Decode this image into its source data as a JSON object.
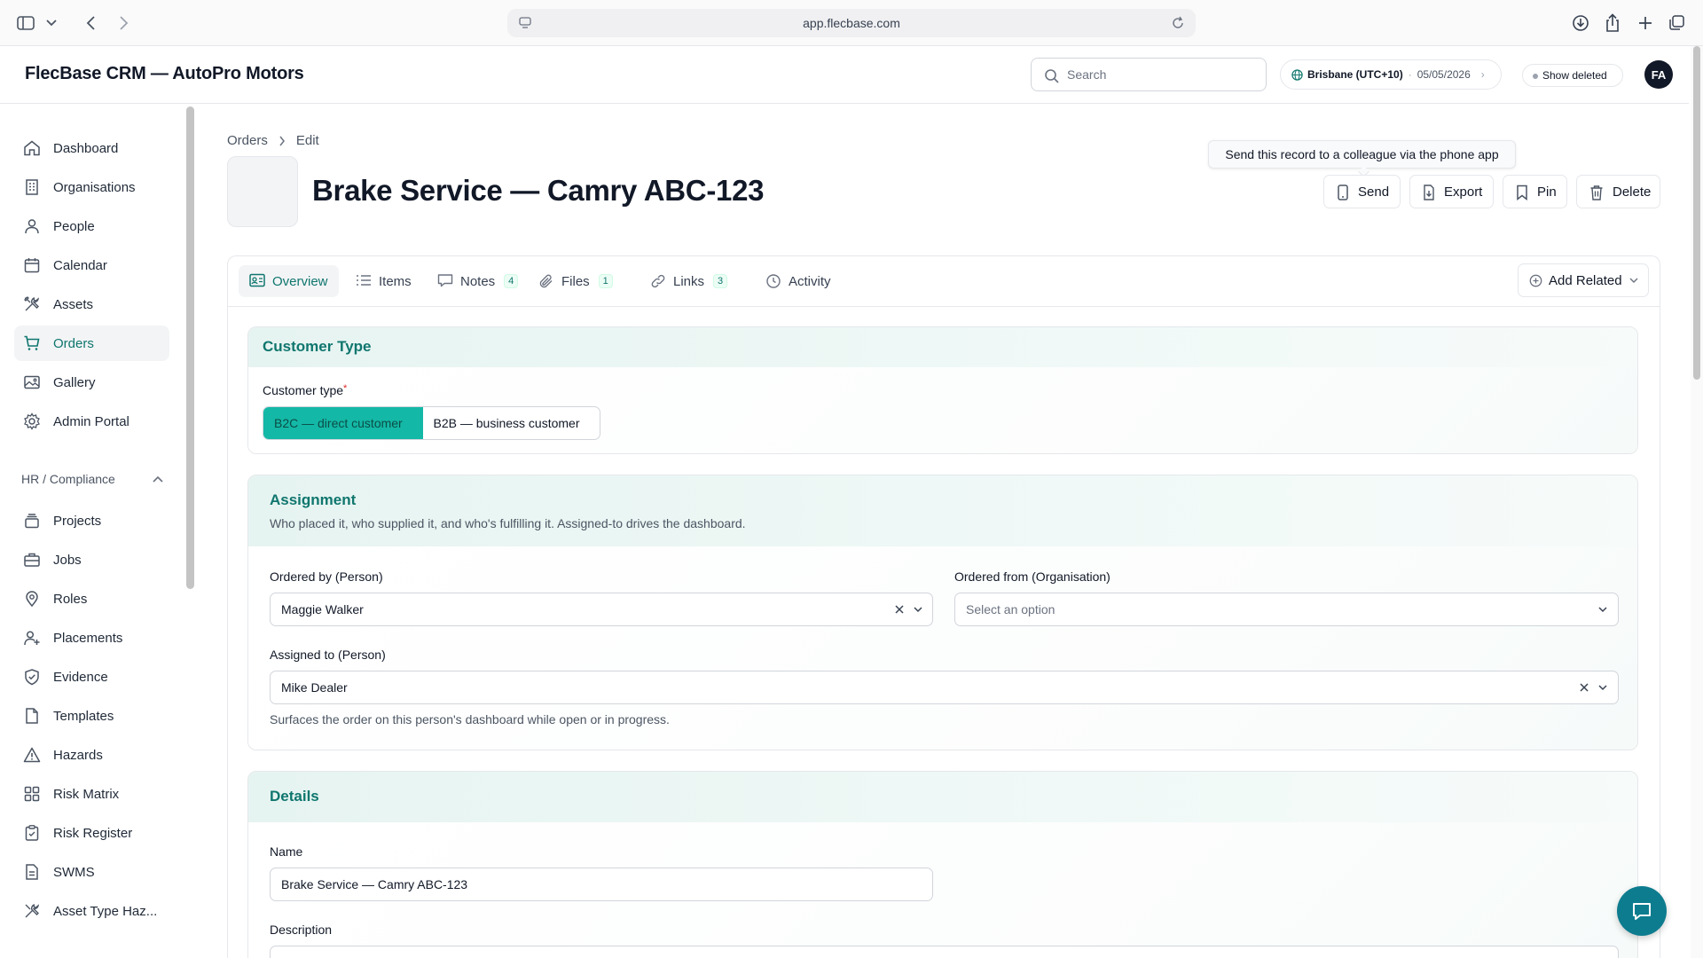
{
  "browser": {
    "url": "app.flecbase.com"
  },
  "app": {
    "brand": "FlecBase CRM — AutoPro Motors",
    "search_placeholder": "Search",
    "timezone": "Brisbane (UTC+10)",
    "date": "05/05/2026",
    "show_deleted": "Show deleted",
    "avatar_initials": "FA"
  },
  "sidebar": {
    "items": [
      {
        "label": "Dashboard",
        "icon": "home-icon"
      },
      {
        "label": "Organisations",
        "icon": "building-icon"
      },
      {
        "label": "People",
        "icon": "person-icon"
      },
      {
        "label": "Calendar",
        "icon": "calendar-icon"
      },
      {
        "label": "Assets",
        "icon": "tools-icon"
      },
      {
        "label": "Orders",
        "icon": "cart-icon",
        "active": true
      },
      {
        "label": "Gallery",
        "icon": "image-icon"
      },
      {
        "label": "Admin Portal",
        "icon": "gear-icon"
      }
    ],
    "section_label": "HR / Compliance",
    "section_items": [
      {
        "label": "Projects",
        "icon": "stack-icon"
      },
      {
        "label": "Jobs",
        "icon": "briefcase-icon"
      },
      {
        "label": "Roles",
        "icon": "pin-icon"
      },
      {
        "label": "Placements",
        "icon": "person-plus-icon"
      },
      {
        "label": "Evidence",
        "icon": "shield-check-icon"
      },
      {
        "label": "Templates",
        "icon": "document-icon"
      },
      {
        "label": "Hazards",
        "icon": "warning-icon"
      },
      {
        "label": "Risk Matrix",
        "icon": "grid-icon"
      },
      {
        "label": "Risk Register",
        "icon": "clipboard-icon"
      },
      {
        "label": "SWMS",
        "icon": "file-icon"
      },
      {
        "label": "Asset Type Haz...",
        "icon": "tools-icon"
      }
    ]
  },
  "page": {
    "breadcrumb": [
      "Orders",
      "Edit"
    ],
    "title": "Brake Service — Camry ABC-123",
    "tooltip": "Send this record to a colleague via the phone app",
    "actions": {
      "send": "Send",
      "export": "Export",
      "pin": "Pin",
      "delete": "Delete"
    }
  },
  "tabs": [
    {
      "label": "Overview",
      "active": true
    },
    {
      "label": "Items"
    },
    {
      "label": "Notes",
      "count": "4"
    },
    {
      "label": "Files",
      "count": "1"
    },
    {
      "label": "Links",
      "count": "3"
    },
    {
      "label": "Activity"
    }
  ],
  "add_related": "Add Related",
  "sections": {
    "customer_type": {
      "title": "Customer Type",
      "field_label": "Customer type",
      "required_mark": "*",
      "options": [
        "B2C — direct customer",
        "B2B — business customer"
      ],
      "selected": 0
    },
    "assignment": {
      "title": "Assignment",
      "subtitle": "Who placed it, who supplied it, and who's fulfilling it. Assigned-to drives the dashboard.",
      "ordered_by_label": "Ordered by (Person)",
      "ordered_by_value": "Maggie Walker",
      "ordered_from_label": "Ordered from (Organisation)",
      "ordered_from_placeholder": "Select an option",
      "assigned_to_label": "Assigned to (Person)",
      "assigned_to_value": "Mike Dealer",
      "assigned_to_help": "Surfaces the order on this person's dashboard while open or in progress."
    },
    "details": {
      "title": "Details",
      "name_label": "Name",
      "name_value": "Brake Service — Camry ABC-123",
      "description_label": "Description"
    }
  },
  "colors": {
    "accent": "#0f766e",
    "selected_segment": "#14b8a6",
    "chat_button": "#0e7c8f"
  }
}
